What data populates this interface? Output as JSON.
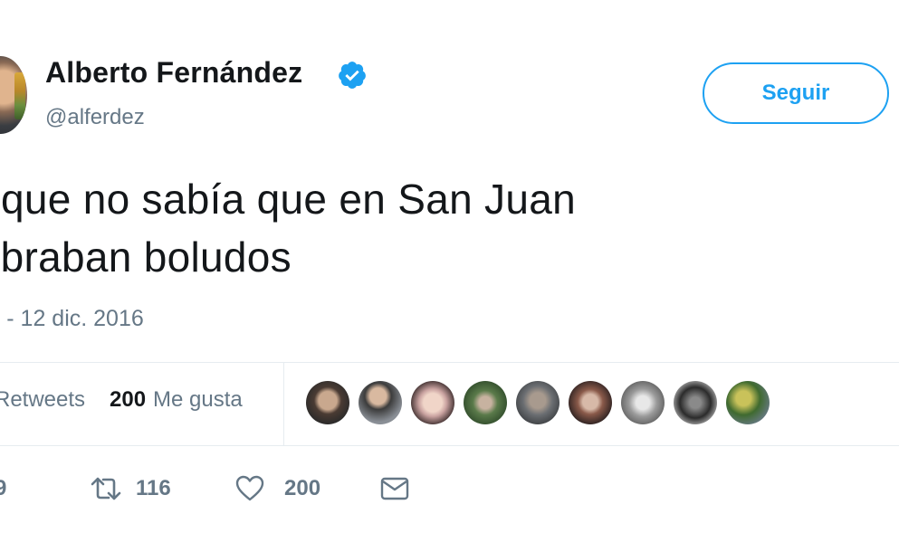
{
  "header": {
    "display_name": "Alberto Fernández",
    "handle": "@alferdez",
    "follow_label": "Seguir"
  },
  "tweet": {
    "lines": [
      "o que no sabía que en San Juan",
      "mbraban boludos"
    ],
    "timestamp": "· - 12 dic. 2016"
  },
  "stats": {
    "retweets_label": "Retweets",
    "likes_count": "200",
    "likes_label": "Me gusta"
  },
  "likers": [
    {
      "name": "liker-1"
    },
    {
      "name": "liker-2"
    },
    {
      "name": "liker-3"
    },
    {
      "name": "liker-4"
    },
    {
      "name": "liker-5"
    },
    {
      "name": "liker-6"
    },
    {
      "name": "liker-7"
    },
    {
      "name": "liker-8"
    },
    {
      "name": "liker-9"
    }
  ],
  "actions": {
    "reply_count": "9",
    "retweet_count": "116",
    "like_count": "200"
  },
  "icons": {
    "verified": "verified-badge-icon",
    "retweet": "retweet-icon",
    "like": "heart-icon",
    "dm": "envelope-icon"
  },
  "colors": {
    "accent": "#1da1f2",
    "text": "#14171a",
    "muted": "#657786",
    "border": "#e6ecf0"
  }
}
